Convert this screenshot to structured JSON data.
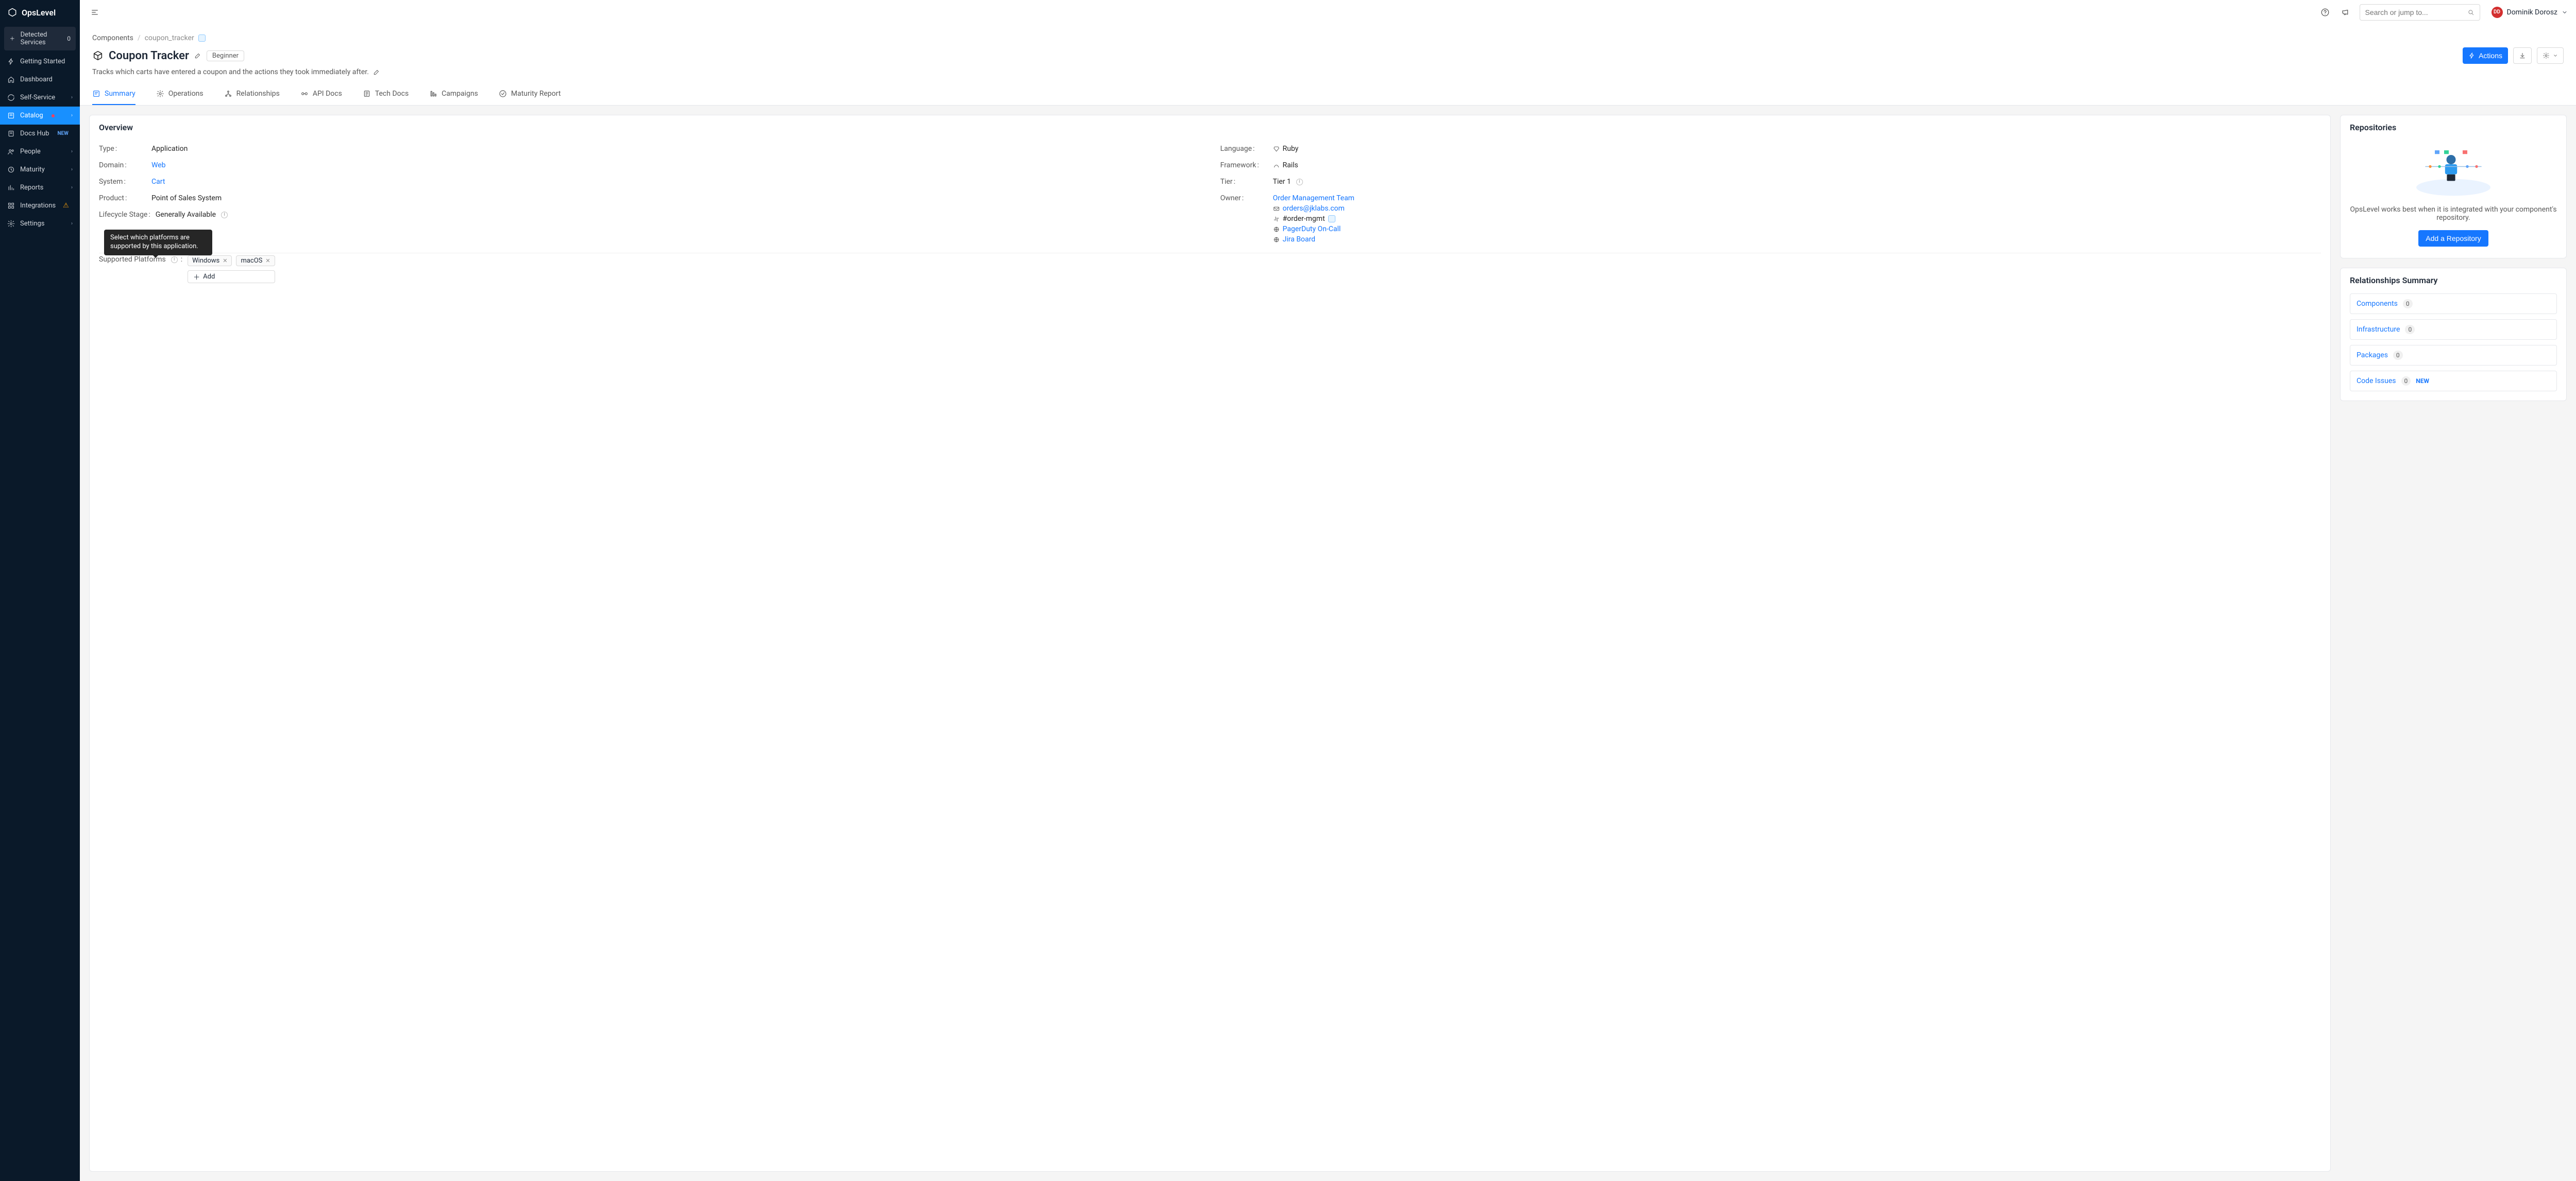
{
  "brand": "OpsLevel",
  "sidebar": {
    "detected": {
      "label": "Detected Services",
      "count": "0"
    },
    "items": [
      {
        "icon": "bolt",
        "label": "Getting Started"
      },
      {
        "icon": "home",
        "label": "Dashboard"
      },
      {
        "icon": "refresh",
        "label": "Self-Service",
        "chev": true
      },
      {
        "icon": "catalog",
        "label": "Catalog",
        "active": true,
        "dot": true,
        "chev": true
      },
      {
        "icon": "docs",
        "label": "Docs Hub",
        "new_badge": "NEW"
      },
      {
        "icon": "people",
        "label": "People",
        "chev": true
      },
      {
        "icon": "clock",
        "label": "Maturity",
        "chev": true
      },
      {
        "icon": "chart",
        "label": "Reports",
        "chev": true
      },
      {
        "icon": "grid",
        "label": "Integrations",
        "warn": true
      },
      {
        "icon": "gear",
        "label": "Settings",
        "chev": true
      }
    ]
  },
  "topbar": {
    "search_placeholder": "Search or jump to...",
    "user": {
      "initials": "DD",
      "name": "Dominik Dorosz"
    }
  },
  "breadcrumbs": {
    "root": "Components",
    "current": "coupon_tracker"
  },
  "page": {
    "title": "Coupon Tracker",
    "level": "Beginner",
    "description": "Tracks which carts have entered a coupon and the actions they took immediately after.",
    "actions_label": "Actions"
  },
  "tabs": [
    {
      "label": "Summary",
      "active": true
    },
    {
      "label": "Operations"
    },
    {
      "label": "Relationships"
    },
    {
      "label": "API Docs"
    },
    {
      "label": "Tech Docs"
    },
    {
      "label": "Campaigns"
    },
    {
      "label": "Maturity Report"
    }
  ],
  "overview": {
    "heading": "Overview",
    "left": {
      "type": {
        "label": "Type",
        "value": "Application"
      },
      "domain": {
        "label": "Domain",
        "value": "Web"
      },
      "system": {
        "label": "System",
        "value": "Cart"
      },
      "product": {
        "label": "Product",
        "value": "Point of Sales System"
      },
      "lifecycle": {
        "label": "Lifecycle Stage",
        "value": "Generally Available"
      }
    },
    "right": {
      "language": {
        "label": "Language",
        "value": "Ruby"
      },
      "framework": {
        "label": "Framework",
        "value": "Rails"
      },
      "tier": {
        "label": "Tier",
        "value": "Tier 1"
      },
      "owner": {
        "label": "Owner",
        "team": "Order Management Team",
        "email": "orders@jklabs.com",
        "slack": "#order-mgmt",
        "pagerduty": "PagerDuty On-Call",
        "jira": "Jira Board"
      }
    },
    "platforms": {
      "label": "Supported Platforms",
      "tooltip": "Select which platforms are supported by this application.",
      "values": [
        "Windows",
        "macOS"
      ],
      "add_label": "Add"
    }
  },
  "repos": {
    "heading": "Repositories",
    "text": "OpsLevel works best when it is integrated with your component's repository.",
    "button": "Add a Repository"
  },
  "relationships": {
    "heading": "Relationships Summary",
    "items": [
      {
        "label": "Components",
        "count": "0"
      },
      {
        "label": "Infrastructure",
        "count": "0"
      },
      {
        "label": "Packages",
        "count": "0"
      },
      {
        "label": "Code Issues",
        "count": "0",
        "new": "NEW"
      }
    ]
  }
}
